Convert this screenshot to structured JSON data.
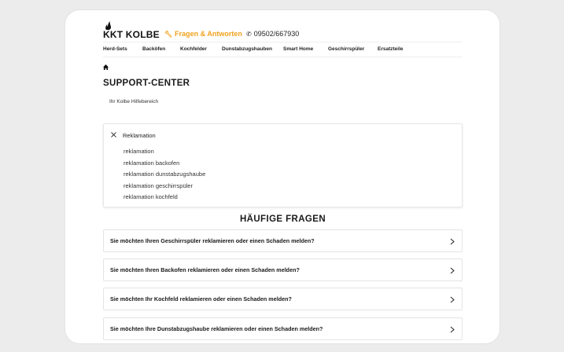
{
  "header": {
    "logo_text": "KKT KOLBE",
    "faq_link": "Fragen & Antworten",
    "phone": "09502/667930"
  },
  "nav": {
    "items": [
      "Herd-Sets",
      "Backöfen",
      "Kochfelder",
      "Dunstabzugshauben",
      "Smart Home",
      "Geschirrspüler",
      "Ersatzteile"
    ]
  },
  "page": {
    "title": "SUPPORT-CENTER",
    "subtitle": "Ihr Kolbe Hilfebereich"
  },
  "search": {
    "value": "Reklamation",
    "suggestions": [
      "reklamation",
      "reklamation backofen",
      "reklamation dunstabzugshaube",
      "reklamation geschirrspüler",
      "reklamation kochfeld"
    ]
  },
  "faq": {
    "heading": "HÄUFIGE FRAGEN",
    "items": [
      "Sie möchten Ihren Geschirrspüler reklamieren oder einen Schaden melden?",
      "Sie möchten Ihren Backofen reklamieren oder einen Schaden melden?",
      "Sie möchten Ihr Kochfeld reklamieren oder einen Schaden melden?",
      "Sie möchten Ihre Dunstabzugshaube reklamieren oder einen Schaden melden?"
    ]
  },
  "colors": {
    "accent": "#f0a21c",
    "text": "#1a1a1a",
    "background": "#ececec"
  },
  "icons": [
    "flame-icon",
    "wrench-icon",
    "phone-icon",
    "home-icon",
    "close-icon",
    "chevron-right-icon"
  ]
}
